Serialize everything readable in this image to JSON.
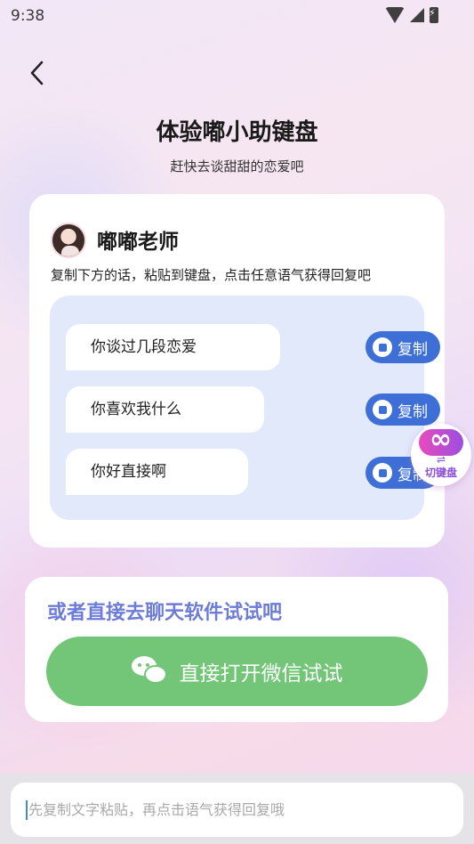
{
  "status_bar": {
    "time": "9:38"
  },
  "header": {
    "title": "体验嘟小助键盘",
    "subtitle": "赶快去谈甜甜的恋爱吧"
  },
  "teacher_card": {
    "name": "嘟嘟老师",
    "instruction": "复制下方的话，粘贴到键盘，点击任意语气获得回复吧",
    "phrases": [
      {
        "text": "你谈过几段恋爱",
        "copy_label": "复制"
      },
      {
        "text": "你喜欢我什么",
        "copy_label": "复制"
      },
      {
        "text": "你好直接啊",
        "copy_label": "复制"
      }
    ]
  },
  "floating_switch": {
    "arrows": "⇌",
    "label": "切键盘"
  },
  "alt_card": {
    "heading": "或者直接去聊天软件试试吧",
    "wechat_button": "直接打开微信试试"
  },
  "input": {
    "placeholder": "先复制文字粘贴，再点击语气获得回复哦",
    "value": ""
  },
  "colors": {
    "accent_blue": "#3d6fd6",
    "wechat_green": "#73c577",
    "heading_purple": "#6c7cd8"
  }
}
